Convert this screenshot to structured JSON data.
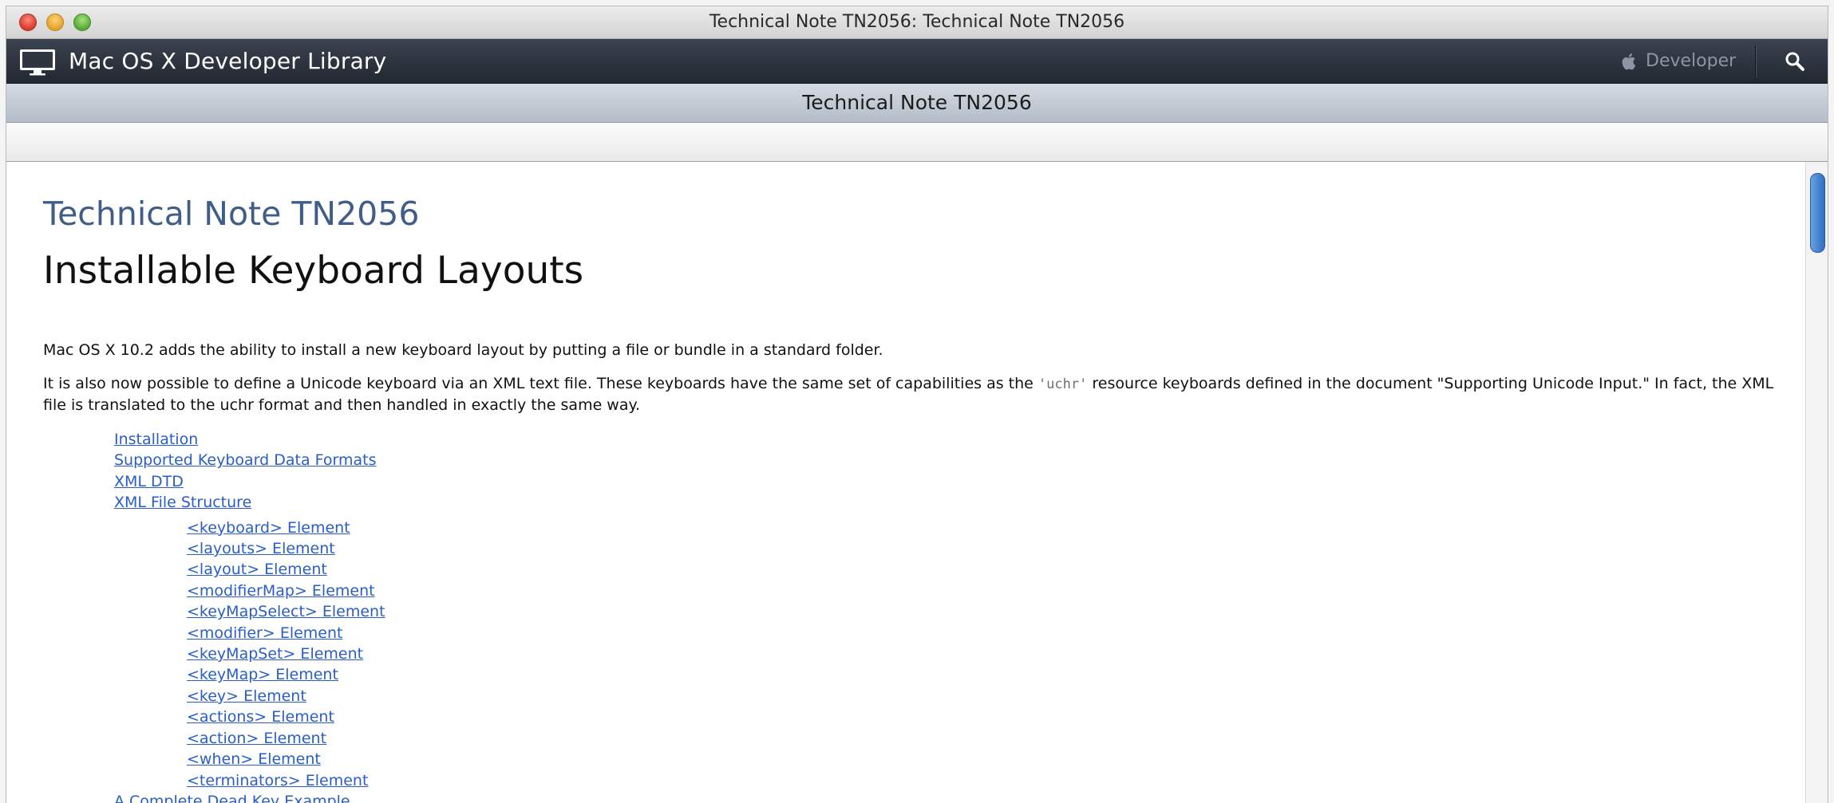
{
  "window": {
    "title": "Technical Note TN2056: Technical Note TN2056"
  },
  "library_bar": {
    "title": "Mac OS X Developer Library",
    "developer_link": "Developer",
    "icons": [
      "monitor-icon",
      "apple-icon",
      "search-icon"
    ]
  },
  "doc_bar": {
    "title": "Technical Note TN2056"
  },
  "article": {
    "kicker": "Technical Note TN2056",
    "heading": "Installable Keyboard Layouts",
    "intro": "Mac OS X 10.2 adds the ability to install a new keyboard layout by putting a file or bundle in a standard folder.",
    "para2_before": "It is also now possible to define a Unicode keyboard via an XML text file. These keyboards have the same set of capabilities as the ",
    "para2_code": "'uchr'",
    "para2_after": " resource keyboards defined in the document \"Supporting Unicode Input.\" In fact, the XML file is translated to the uchr format and then handled in exactly the same way.",
    "toc": [
      "Installation",
      "Supported Keyboard Data Formats",
      "XML DTD",
      "XML File Structure"
    ],
    "toc_sub": [
      "<keyboard> Element",
      "<layouts> Element",
      "<layout> Element",
      "<modifierMap> Element",
      "<keyMapSelect> Element",
      "<modifier> Element",
      "<keyMapSet> Element",
      "<keyMap> Element",
      "<key> Element",
      "<actions> Element",
      "<action> Element",
      "<when> Element",
      "<terminators> Element"
    ],
    "toc_after": [
      "A Complete Dead Key Example"
    ]
  },
  "colors": {
    "link": "#2a5ec7",
    "kicker": "#3f5d86",
    "library_bar": "#2b313b",
    "scroll_thumb": "#3f7fd0"
  }
}
